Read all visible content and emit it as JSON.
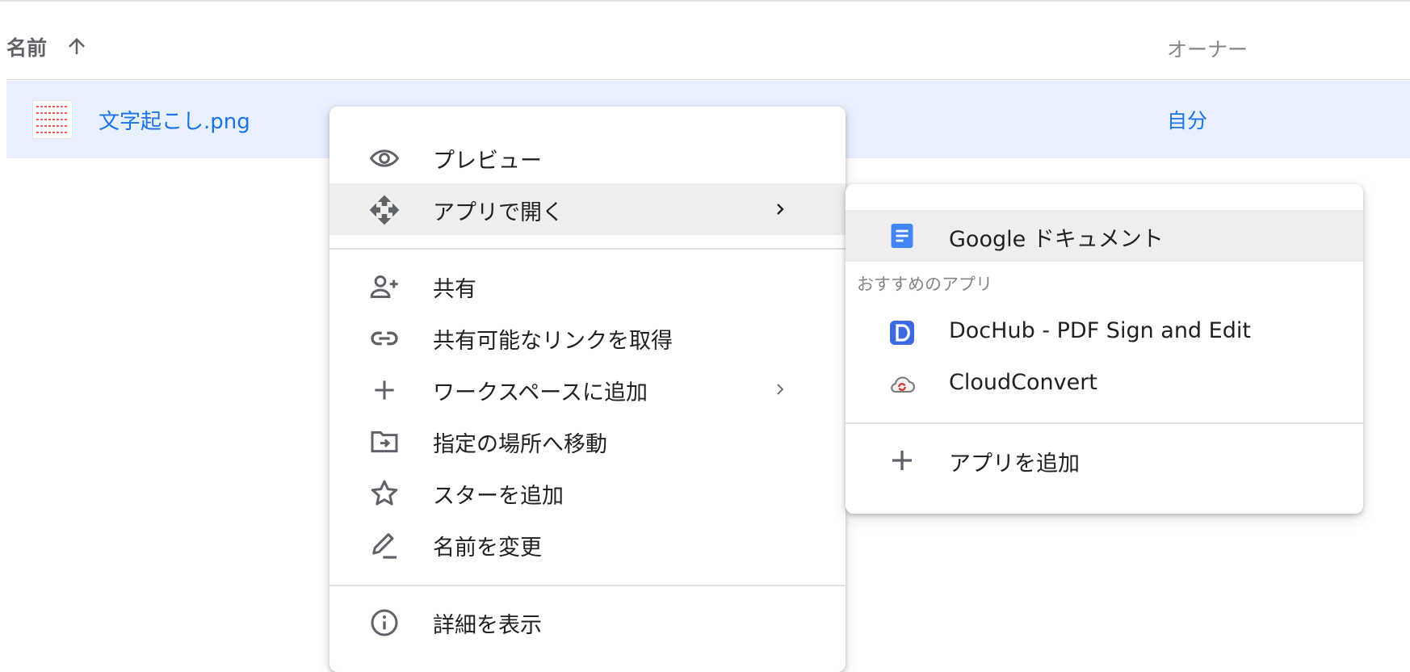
{
  "list": {
    "header": {
      "name_label": "名前",
      "sort_icon": "arrow-up-icon",
      "owner_label": "オーナー"
    },
    "rows": [
      {
        "name": "文字起こし.png",
        "owner": "自分",
        "thumbnail": "image-thumbnail"
      }
    ]
  },
  "context_menu": {
    "items": [
      {
        "label": "プレビュー",
        "icon": "eye-icon"
      },
      {
        "label": "アプリで開く",
        "icon": "open-with-icon",
        "has_submenu": true,
        "highlighted": true
      },
      {
        "label": "共有",
        "icon": "person-add-icon"
      },
      {
        "label": "共有可能なリンクを取得",
        "icon": "link-icon"
      },
      {
        "label": "ワークスペースに追加",
        "icon": "plus-icon",
        "has_submenu": true
      },
      {
        "label": "指定の場所へ移動",
        "icon": "move-to-folder-icon"
      },
      {
        "label": "スターを追加",
        "icon": "star-outline-icon"
      },
      {
        "label": "名前を変更",
        "icon": "pencil-icon"
      },
      {
        "label": "詳細を表示",
        "icon": "info-icon"
      }
    ]
  },
  "submenu": {
    "primary": {
      "label": "Google ドキュメント",
      "icon": "google-docs-icon",
      "highlighted": true
    },
    "suggested_caption": "おすすめのアプリ",
    "suggested": [
      {
        "label": "DocHub - PDF Sign and Edit",
        "icon": "dochub-icon"
      },
      {
        "label": "CloudConvert",
        "icon": "cloudconvert-icon"
      }
    ],
    "add_app": {
      "label": "アプリを追加",
      "icon": "plus-icon"
    }
  },
  "colors": {
    "accent": "#1a73e8",
    "row_selected": "#e8f0fe",
    "menu_highlight": "#eeeeee",
    "icon_gray": "#5f6368",
    "docs_blue": "#4285f4"
  }
}
